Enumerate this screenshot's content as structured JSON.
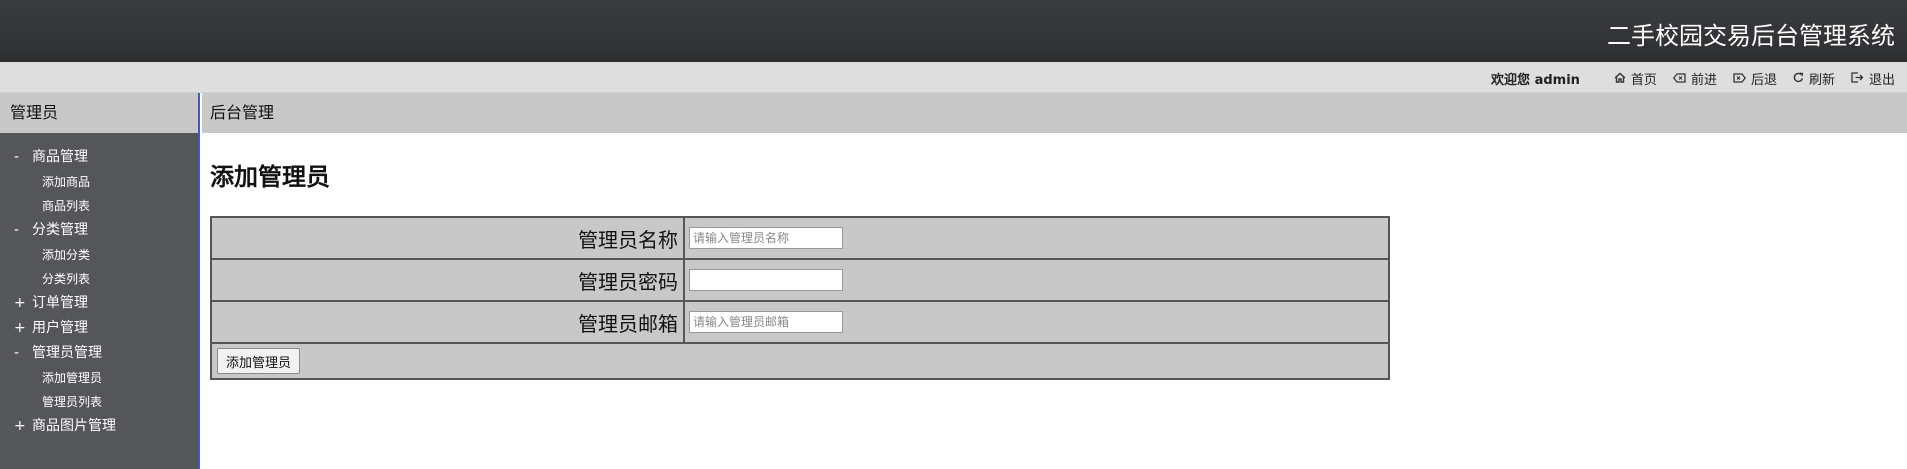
{
  "header": {
    "title": "二手校园交易后台管理系统"
  },
  "topbar": {
    "welcome": "欢迎您 admin",
    "links": [
      {
        "icon": "home-icon",
        "label": "首页"
      },
      {
        "icon": "forward-icon",
        "label": "前进"
      },
      {
        "icon": "back-icon",
        "label": "后退"
      },
      {
        "icon": "refresh-icon",
        "label": "刷新"
      },
      {
        "icon": "logout-icon",
        "label": "退出"
      }
    ]
  },
  "sidebar": {
    "heading": "管理员",
    "groups": [
      {
        "toggle": "-",
        "label": "商品管理",
        "items": [
          "添加商品",
          "商品列表"
        ]
      },
      {
        "toggle": "-",
        "label": "分类管理",
        "items": [
          "添加分类",
          "分类列表"
        ]
      },
      {
        "toggle": "+",
        "label": "订单管理",
        "items": []
      },
      {
        "toggle": "+",
        "label": "用户管理",
        "items": []
      },
      {
        "toggle": "-",
        "label": "管理员管理",
        "items": [
          "添加管理员",
          "管理员列表"
        ]
      },
      {
        "toggle": "+",
        "label": "商品图片管理",
        "items": []
      }
    ]
  },
  "content": {
    "breadcrumb": "后台管理",
    "page_title": "添加管理员",
    "form": {
      "name_label": "管理员名称",
      "name_placeholder": "请输入管理员名称",
      "name_value": "",
      "password_label": "管理员密码",
      "password_value": "",
      "email_label": "管理员邮箱",
      "email_placeholder": "请输入管理员邮箱",
      "email_value": "",
      "submit_label": "添加管理员"
    }
  }
}
